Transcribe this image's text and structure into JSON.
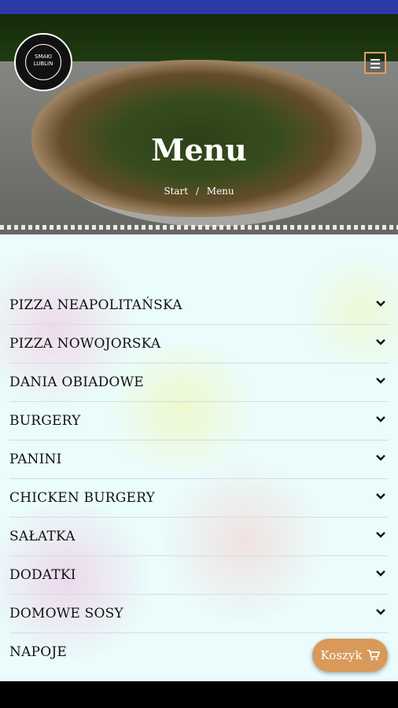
{
  "header": {
    "title": "Menu",
    "breadcrumb": {
      "home": "Start",
      "separator": "/",
      "current": "Menu"
    },
    "logo_text": [
      "SMAKI",
      "LUBLIN"
    ]
  },
  "categories": [
    {
      "label": "PIZZA NEAPOLITAŃSKA"
    },
    {
      "label": "PIZZA NOWOJORSKA"
    },
    {
      "label": "DANIA OBIADOWE"
    },
    {
      "label": "BURGERY"
    },
    {
      "label": "PANINI"
    },
    {
      "label": "CHICKEN BURGERY"
    },
    {
      "label": "SAŁATKA"
    },
    {
      "label": "DODATKI"
    },
    {
      "label": "DOMOWE SOSY"
    },
    {
      "label": "NAPOJE"
    }
  ],
  "cart": {
    "label": "Koszyk",
    "icon": "cart-icon"
  },
  "colors": {
    "accent": "#d8995a",
    "status_bar": "#2b3aa6",
    "background": "#eafcfb"
  }
}
